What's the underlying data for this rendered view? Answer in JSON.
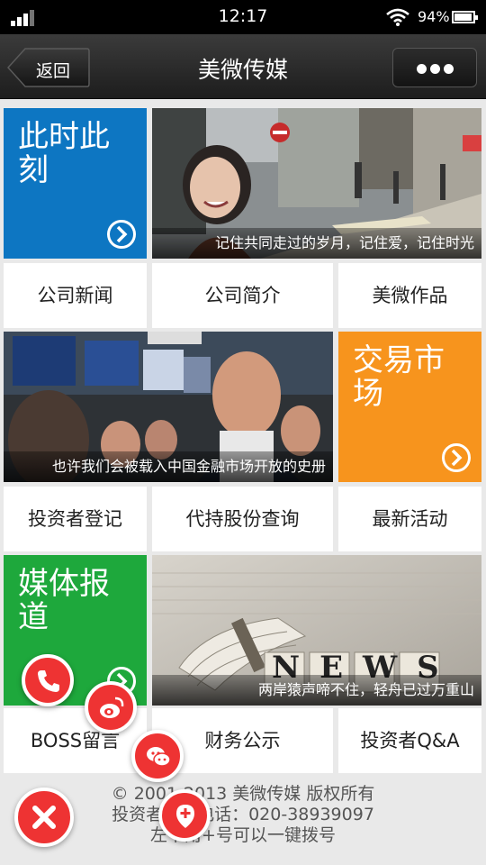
{
  "status_bar": {
    "time": "12:17",
    "battery_percent": "94%",
    "battery_level": 0.94
  },
  "nav": {
    "back_label": "返回",
    "title": "美微传媒",
    "more_icon": "more-dots-icon"
  },
  "tiles": {
    "moment": {
      "title": "此时此刻",
      "color": "#0d76c2"
    },
    "photo1_caption": "记住共同走过的岁月，记住爱，记住时光",
    "company_news": "公司新闻",
    "company_intro": "公司简介",
    "works": "美微作品",
    "photo2_caption": "也许我们会被载入中国金融市场开放的史册",
    "market": {
      "title": "交易市场",
      "color": "#f7941d"
    },
    "investor_register": "投资者登记",
    "share_query": "代持股份查询",
    "latest_events": "最新活动",
    "media": {
      "title": "媒体报道",
      "color": "#1ea83c"
    },
    "photo3_caption": "两岸猿声啼不住，轻舟已过万重山",
    "photo3_sign": "NEWS",
    "boss_message": "BOSS留言",
    "finance": "财务公示",
    "investor_qa": "投资者Q&A"
  },
  "footer": {
    "line1": "© 2001-2013 美微传媒 版权所有",
    "line2": "投资者关系电话：020-38939097",
    "line3": "左下角+号可以一键拨号"
  },
  "fabs": {
    "phone": "phone-icon",
    "weibo": "weibo-icon",
    "wechat": "wechat-icon",
    "location": "location-icon",
    "close": "close-icon"
  }
}
